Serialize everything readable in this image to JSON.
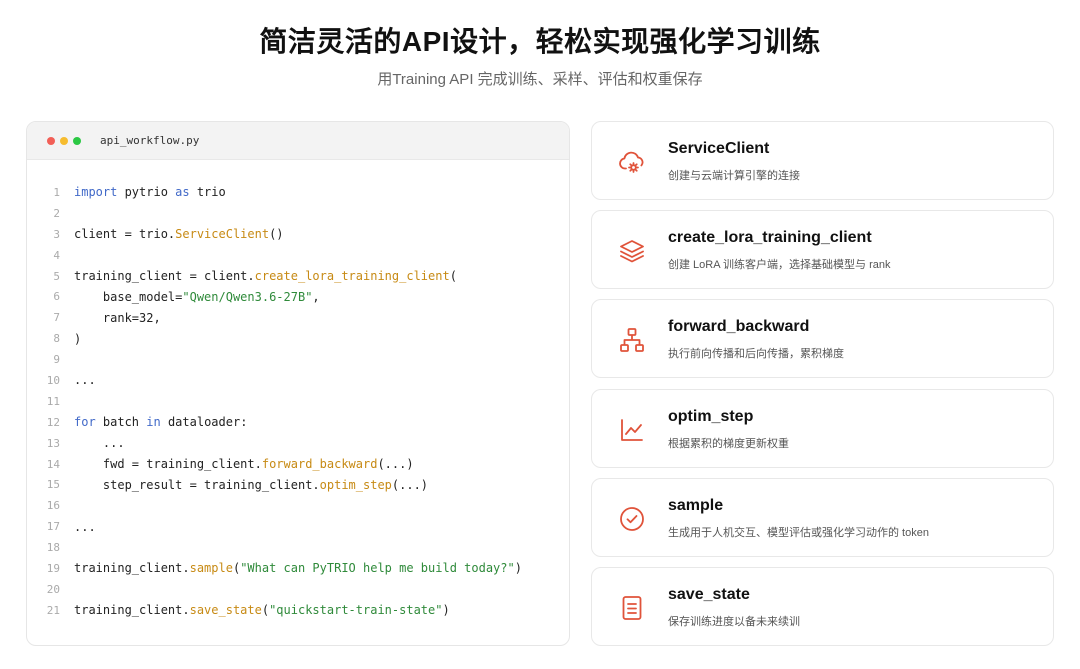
{
  "header": {
    "title": "简洁灵活的API设计，轻松实现强化学习训练",
    "subtitle": "用Training API 完成训练、采样、评估和权重保存"
  },
  "code": {
    "filename": "api_workflow.py",
    "lines": [
      {
        "n": "1",
        "tokens": [
          [
            "kw",
            "import"
          ],
          [
            "t",
            " pytrio "
          ],
          [
            "kw",
            "as"
          ],
          [
            "t",
            " trio"
          ]
        ]
      },
      {
        "n": "2",
        "tokens": []
      },
      {
        "n": "3",
        "tokens": [
          [
            "t",
            "client = trio."
          ],
          [
            "fn",
            "ServiceClient"
          ],
          [
            "t",
            "()"
          ]
        ]
      },
      {
        "n": "4",
        "tokens": []
      },
      {
        "n": "5",
        "tokens": [
          [
            "t",
            "training_client = client."
          ],
          [
            "fn",
            "create_lora_training_client"
          ],
          [
            "t",
            "("
          ]
        ]
      },
      {
        "n": "6",
        "tokens": [
          [
            "t",
            "    base_model="
          ],
          [
            "str",
            "\"Qwen/Qwen3.6-27B\""
          ],
          [
            "t",
            ","
          ]
        ]
      },
      {
        "n": "7",
        "tokens": [
          [
            "t",
            "    rank=32,"
          ]
        ]
      },
      {
        "n": "8",
        "tokens": [
          [
            "t",
            ")"
          ]
        ]
      },
      {
        "n": "9",
        "tokens": []
      },
      {
        "n": "10",
        "tokens": [
          [
            "t",
            "..."
          ]
        ]
      },
      {
        "n": "11",
        "tokens": []
      },
      {
        "n": "12",
        "tokens": [
          [
            "kw",
            "for"
          ],
          [
            "t",
            " batch "
          ],
          [
            "kw",
            "in"
          ],
          [
            "t",
            " dataloader:"
          ]
        ]
      },
      {
        "n": "13",
        "tokens": [
          [
            "t",
            "    ..."
          ]
        ]
      },
      {
        "n": "14",
        "tokens": [
          [
            "t",
            "    fwd = training_client."
          ],
          [
            "fn",
            "forward_backward"
          ],
          [
            "t",
            "(...)"
          ]
        ]
      },
      {
        "n": "15",
        "tokens": [
          [
            "t",
            "    step_result = training_client."
          ],
          [
            "fn",
            "optim_step"
          ],
          [
            "t",
            "(...)"
          ]
        ]
      },
      {
        "n": "16",
        "tokens": []
      },
      {
        "n": "17",
        "tokens": [
          [
            "t",
            "..."
          ]
        ]
      },
      {
        "n": "18",
        "tokens": []
      },
      {
        "n": "19",
        "tokens": [
          [
            "t",
            "training_client."
          ],
          [
            "fn",
            "sample"
          ],
          [
            "t",
            "("
          ],
          [
            "str",
            "\"What can PyTRIO help me build today?\""
          ],
          [
            "t",
            ")"
          ]
        ]
      },
      {
        "n": "20",
        "tokens": []
      },
      {
        "n": "21",
        "tokens": [
          [
            "t",
            "training_client."
          ],
          [
            "fn",
            "save_state"
          ],
          [
            "t",
            "("
          ],
          [
            "str",
            "\"quickstart-train-state\""
          ],
          [
            "t",
            ")"
          ]
        ]
      }
    ]
  },
  "cards": [
    {
      "icon": "cloud-gear-icon",
      "title": "ServiceClient",
      "desc": "创建与云端计算引擎的连接"
    },
    {
      "icon": "layers-icon",
      "title": "create_lora_training_client",
      "desc": "创建 LoRA 训练客户端，选择基础模型与 rank"
    },
    {
      "icon": "network-icon",
      "title": "forward_backward",
      "desc": "执行前向传播和后向传播，累积梯度"
    },
    {
      "icon": "line-chart-icon",
      "title": "optim_step",
      "desc": "根据累积的梯度更新权重"
    },
    {
      "icon": "check-circle-icon",
      "title": "sample",
      "desc": "生成用于人机交互、模型评估或强化学习动作的 token"
    },
    {
      "icon": "document-icon",
      "title": "save_state",
      "desc": "保存训练进度以备未来续训"
    }
  ],
  "colors": {
    "accent": "#e0533a",
    "keyword": "#4169c8",
    "function": "#c78a14",
    "string": "#2f8a3a"
  }
}
